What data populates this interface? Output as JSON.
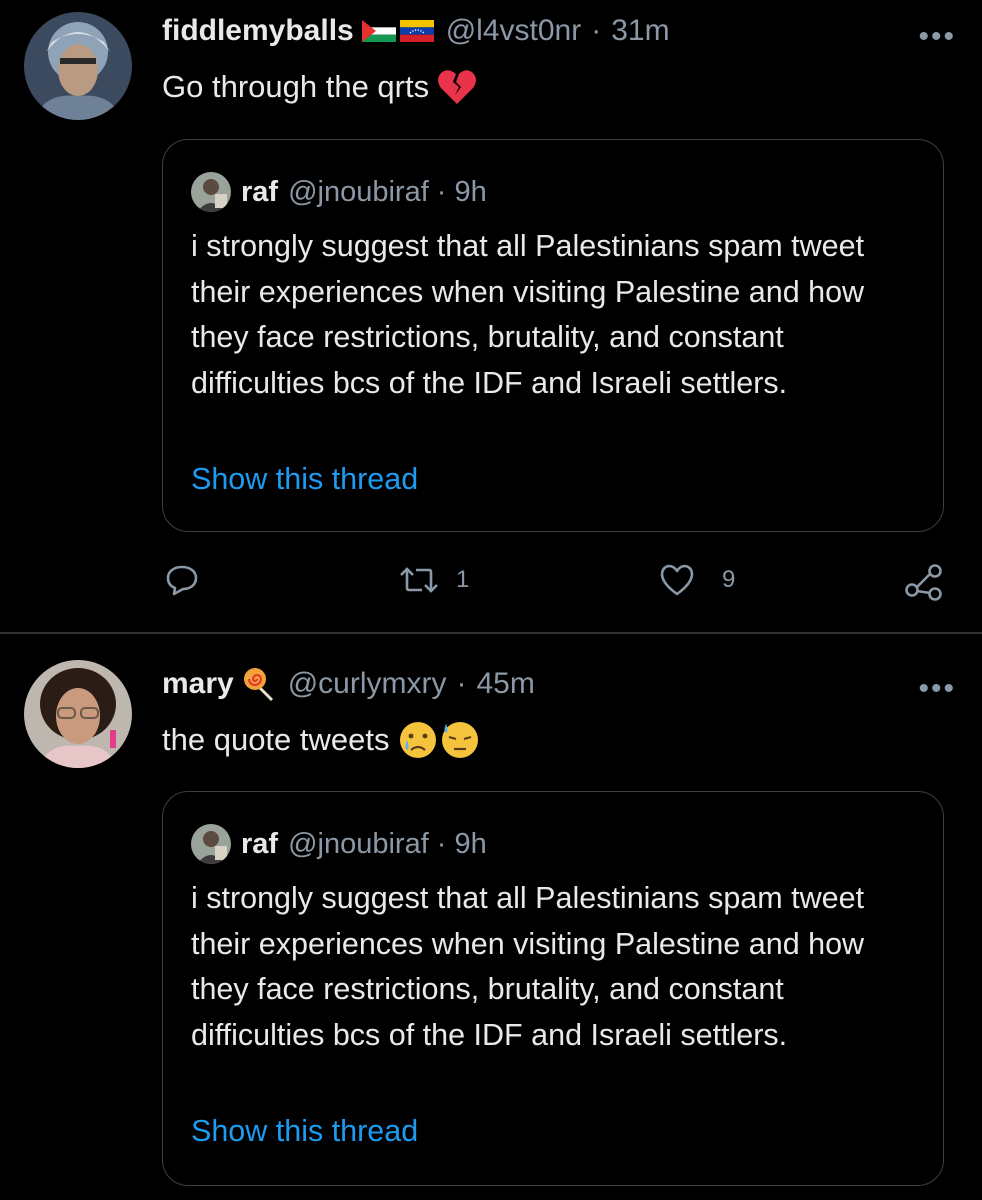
{
  "tweets": [
    {
      "display_name": "fiddlemyballs",
      "handle": "@l4vst0nr",
      "separator": "·",
      "time": "31m",
      "more_label": "•••",
      "text": "Go through the qrts",
      "text_emoji": "broken-heart",
      "name_flags": [
        "palestine-flag",
        "venezuela-flag"
      ],
      "quote": {
        "display_name": "raf",
        "handle": "@jnoubiraf",
        "separator": "·",
        "time": "9h",
        "text": "i strongly suggest that all Palestinians spam tweet their experiences when visiting Palestine and how they face restrictions, brutality, and constant difficulties bcs of the IDF and Israeli settlers.",
        "link": "Show this thread"
      },
      "actions": {
        "reply_icon": "reply-icon",
        "retweets": "1",
        "retweet_icon": "retweet-icon",
        "likes": "9",
        "like_icon": "heart-icon",
        "share_icon": "share-icon"
      }
    },
    {
      "display_name": "mary",
      "handle": "@curlymxry",
      "separator": "·",
      "time": "45m",
      "more_label": "•••",
      "text": "the quote tweets",
      "name_emoji": "lollipop",
      "text_emojis": [
        "crying-face",
        "downcast-sweat-face"
      ],
      "quote": {
        "display_name": "raf",
        "handle": "@jnoubiraf",
        "separator": "·",
        "time": "9h",
        "text": "i strongly suggest that all Palestinians spam tweet their experiences when visiting Palestine and how they face restrictions, brutality, and constant difficulties bcs of the IDF and Israeli settlers.",
        "link": "Show this thread"
      }
    }
  ],
  "colors": {
    "background": "#000000",
    "text": "#e7e9ea",
    "muted": "#8b98a5",
    "link": "#1d9bf0",
    "border": "#3a3f44"
  }
}
